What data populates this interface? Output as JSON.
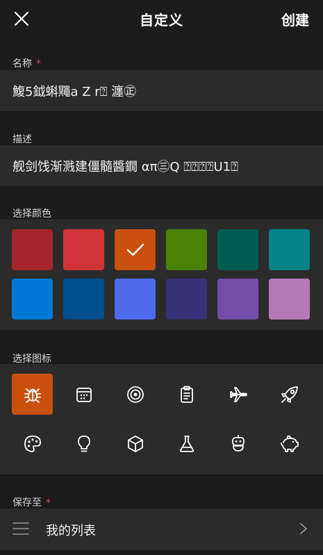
{
  "header": {
    "close_icon": "close-icon",
    "title": "自定义",
    "create_label": "创建"
  },
  "name_section": {
    "label": "名称",
    "required_mark": "*",
    "value": "鰒5鉞蝌鼆a Z r⍰ 瀍㊣"
  },
  "desc_section": {
    "label": "描述",
    "value": "舰剑饯渐溅建僵髓醬鐗 απ㊂Q ⍰⍰⍰⍰U1⍰"
  },
  "color_section": {
    "label": "选择颜色",
    "selected_index": 2,
    "colors": [
      "#a4262c",
      "#d13438",
      "#ca5010",
      "#498205",
      "#005e50",
      "#038387",
      "#0078d4",
      "#004e8c",
      "#4f6bed",
      "#373277",
      "#744da9",
      "#b579b8"
    ]
  },
  "icon_section": {
    "label": "选择图标",
    "selected_index": 0,
    "icons": [
      "bug-icon",
      "calendar-icon",
      "target-icon",
      "clipboard-icon",
      "airplane-icon",
      "rocket-icon",
      "palette-icon",
      "lightbulb-icon",
      "cube-icon",
      "flask-icon",
      "robot-icon",
      "piggy-bank-icon"
    ]
  },
  "save_section": {
    "label": "保存至",
    "required_mark": "*",
    "list_icon": "list-menu-icon",
    "value": "我的列表",
    "chevron_icon": "chevron-right-icon"
  }
}
